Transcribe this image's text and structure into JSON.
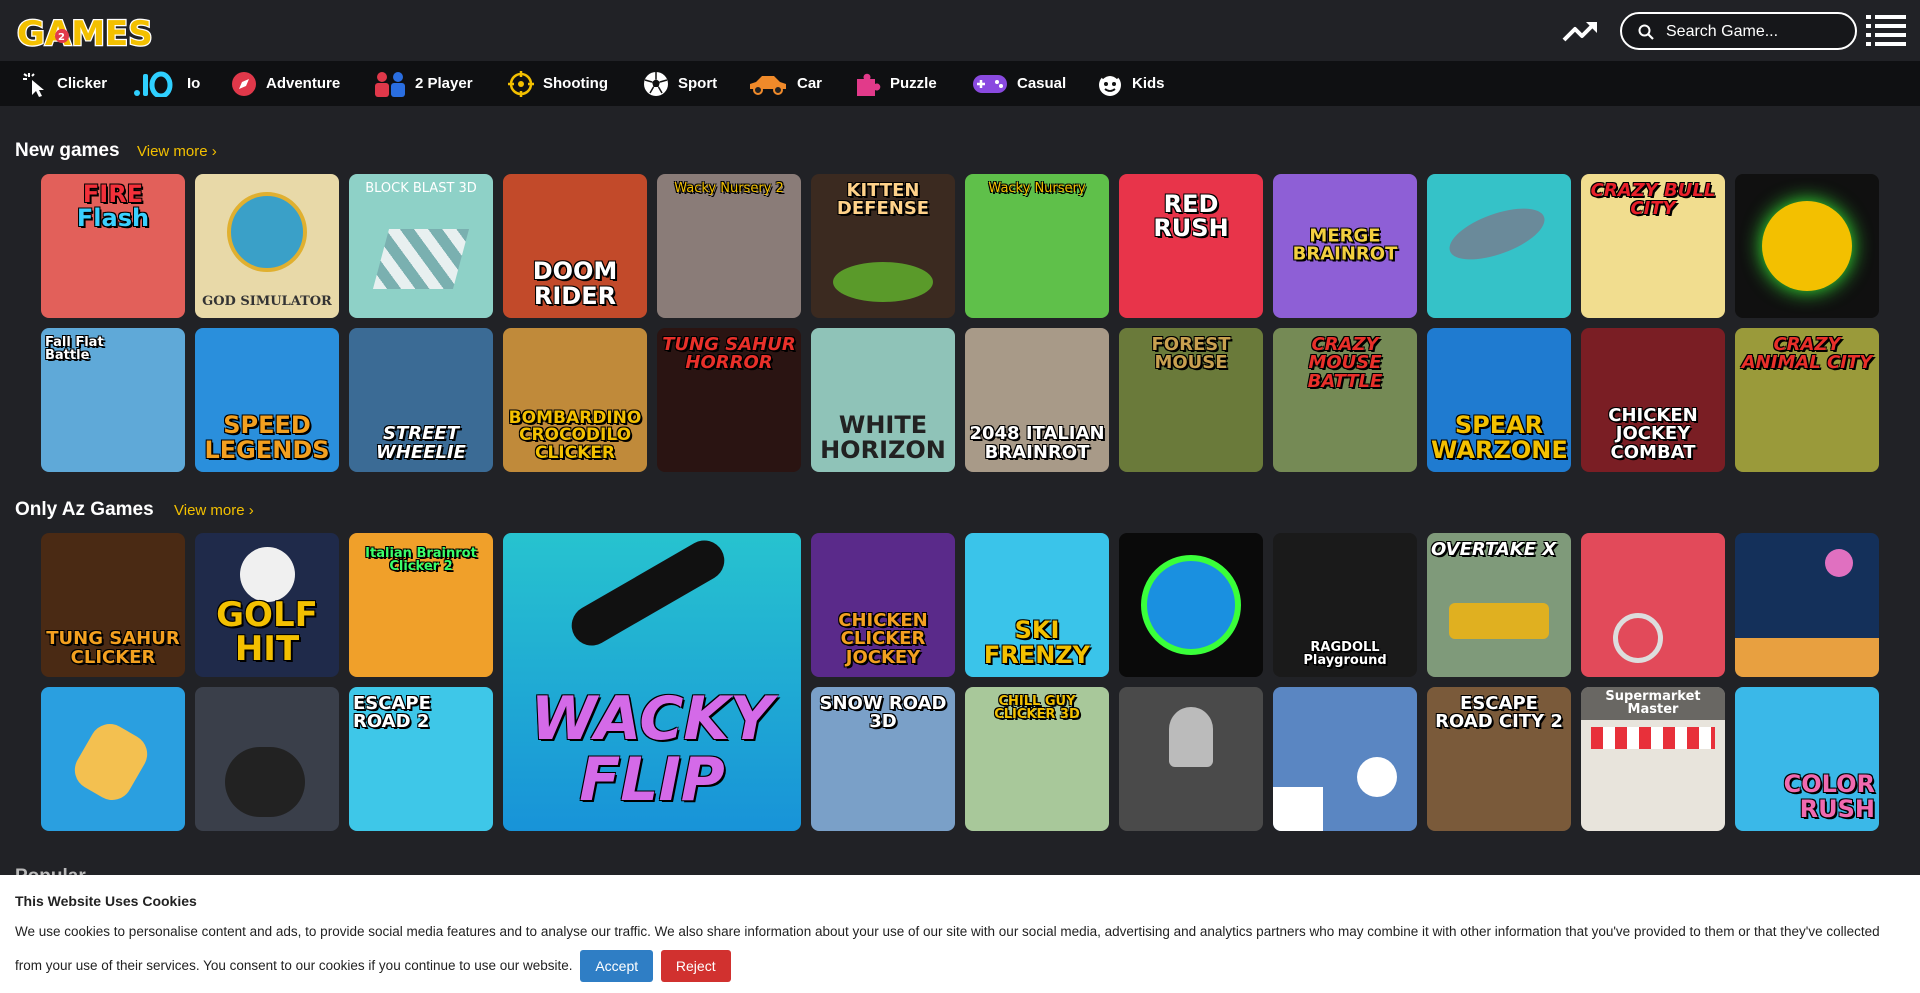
{
  "header": {
    "logo_text": "GAMES",
    "search_placeholder": "Search Game...",
    "icons": {
      "trending": "trending-up-icon",
      "search": "search-icon",
      "menu": "menu-list-icon"
    }
  },
  "categories": [
    {
      "label": "Clicker",
      "icon": "cursor-click-icon"
    },
    {
      "label": "Io",
      "icon": "io-icon"
    },
    {
      "label": "Adventure",
      "icon": "compass-icon"
    },
    {
      "label": "2 Player",
      "icon": "two-player-icon"
    },
    {
      "label": "Shooting",
      "icon": "crosshair-icon"
    },
    {
      "label": "Sport",
      "icon": "soccer-ball-icon"
    },
    {
      "label": "Car",
      "icon": "car-icon"
    },
    {
      "label": "Puzzle",
      "icon": "puzzle-piece-icon"
    },
    {
      "label": "Casual",
      "icon": "gamepad-icon"
    },
    {
      "label": "Kids",
      "icon": "kids-face-icon"
    }
  ],
  "sections": {
    "new_games": {
      "title": "New games",
      "view_more": "View more ›",
      "tiles": [
        {
          "text": "FIRE Flash",
          "bg": "#e2605a"
        },
        {
          "text": "GOD SIMULATOR",
          "bg": "#e8d9a8"
        },
        {
          "text": "BLOCK BLAST 3D",
          "bg": "#8ed1c7"
        },
        {
          "text": "DOOM RIDER",
          "bg": "#c24a2a"
        },
        {
          "text": "Wacky Nursery 2",
          "bg": "#8a7c78"
        },
        {
          "text": "KITTEN DEFENSE",
          "bg": "#3b2a20"
        },
        {
          "text": "Wacky Nursery",
          "bg": "#5fc04a"
        },
        {
          "text": "RED RUSH",
          "bg": "#e8344a"
        },
        {
          "text": "MERGE BRAINROT",
          "bg": "#8e5fd6"
        },
        {
          "text": "",
          "bg": "#35c2c8"
        },
        {
          "text": "CRAZY BULL CITY",
          "bg": "#f1dd8f"
        },
        {
          "text": "",
          "bg": "#101010"
        },
        {
          "text": "Fall Flat Battle",
          "bg": "#5fa9d8"
        },
        {
          "text": "SPEED LEGENDS",
          "bg": "#2a8fdc"
        },
        {
          "text": "STREET WHEELIE",
          "bg": "#3b6b95"
        },
        {
          "text": "BOMBARDINO CROCODILO CLICKER",
          "bg": "#c08a3a"
        },
        {
          "text": "TUNG SAHUR HORROR",
          "bg": "#2a1412"
        },
        {
          "text": "WHITE HORIZON",
          "bg": "#8fc3b8"
        },
        {
          "text": "2048 ITALIAN BRAINROT",
          "bg": "#a89a88"
        },
        {
          "text": "FOREST MOUSE",
          "bg": "#6a7a3a"
        },
        {
          "text": "CRAZY MOUSE BATTLE",
          "bg": "#758a55"
        },
        {
          "text": "SPEAR WARZONE",
          "bg": "#1f7bd0"
        },
        {
          "text": "CHICKEN JOCKEY COMBAT",
          "bg": "#7a1e24"
        },
        {
          "text": "CRAZY ANIMAL CITY",
          "bg": "#9a9a3a"
        }
      ]
    },
    "only_az": {
      "title": "Only Az Games",
      "view_more": "View more ›",
      "tiles": [
        {
          "text": "TUNG SAHUR CLICKER",
          "bg": "#4a2a14"
        },
        {
          "text": "GOLF HIT",
          "bg": "#1f2a4a"
        },
        {
          "text": "Italian Brainrot Clicker 2",
          "bg": "#f0a02a"
        },
        {
          "text": "CHICKEN CLICKER JOCKEY",
          "bg": "#5a2a8a"
        },
        {
          "text": "SKI FRENZY",
          "bg": "#3ac4ea"
        },
        {
          "text": "",
          "bg": "#0a0a0a"
        },
        {
          "text": "RAGDOLL Playground",
          "bg": "#1a1a1a"
        },
        {
          "text": "OVERTAKE X",
          "bg": "#7f9a7a"
        },
        {
          "text": "",
          "bg": "#e24a5a"
        },
        {
          "text": "",
          "bg": "#14305a"
        },
        {
          "text": "",
          "bg": "#2a9fe0"
        },
        {
          "text": "",
          "bg": "#3a3f4a"
        },
        {
          "text": "ESCAPE ROAD 2",
          "bg": "#3ec7e8"
        },
        {
          "text": "SNOW ROAD 3D",
          "bg": "#7aa0c8"
        },
        {
          "text": "CHILL GUY CLICKER 3D",
          "bg": "#a8c89a"
        },
        {
          "text": "",
          "bg": "#4a4a4a"
        },
        {
          "text": "",
          "bg": "#5a86c2"
        },
        {
          "text": "ESCAPE ROAD CITY 2",
          "bg": "#7a5a3a"
        },
        {
          "text": "Supermarket Master",
          "bg": "#e8e4dc"
        },
        {
          "text": "COLOR RUSH",
          "bg": "#3ab8e8"
        }
      ],
      "featured": {
        "text": "WACKY FLIP",
        "bg": "#27c3cf"
      }
    },
    "next_peek": "Popular"
  },
  "cookie": {
    "title": "This Website Uses Cookies",
    "text": "We use cookies to personalise content and ads, to provide social media features and to analyse our traffic. We also share information about your use of our site with our social media, advertising and analytics partners who may combine it with other information that you've provided to them or that they've collected from your use of their services. You consent to our cookies if you continue to use our website.",
    "accept": "Accept",
    "reject": "Reject"
  }
}
